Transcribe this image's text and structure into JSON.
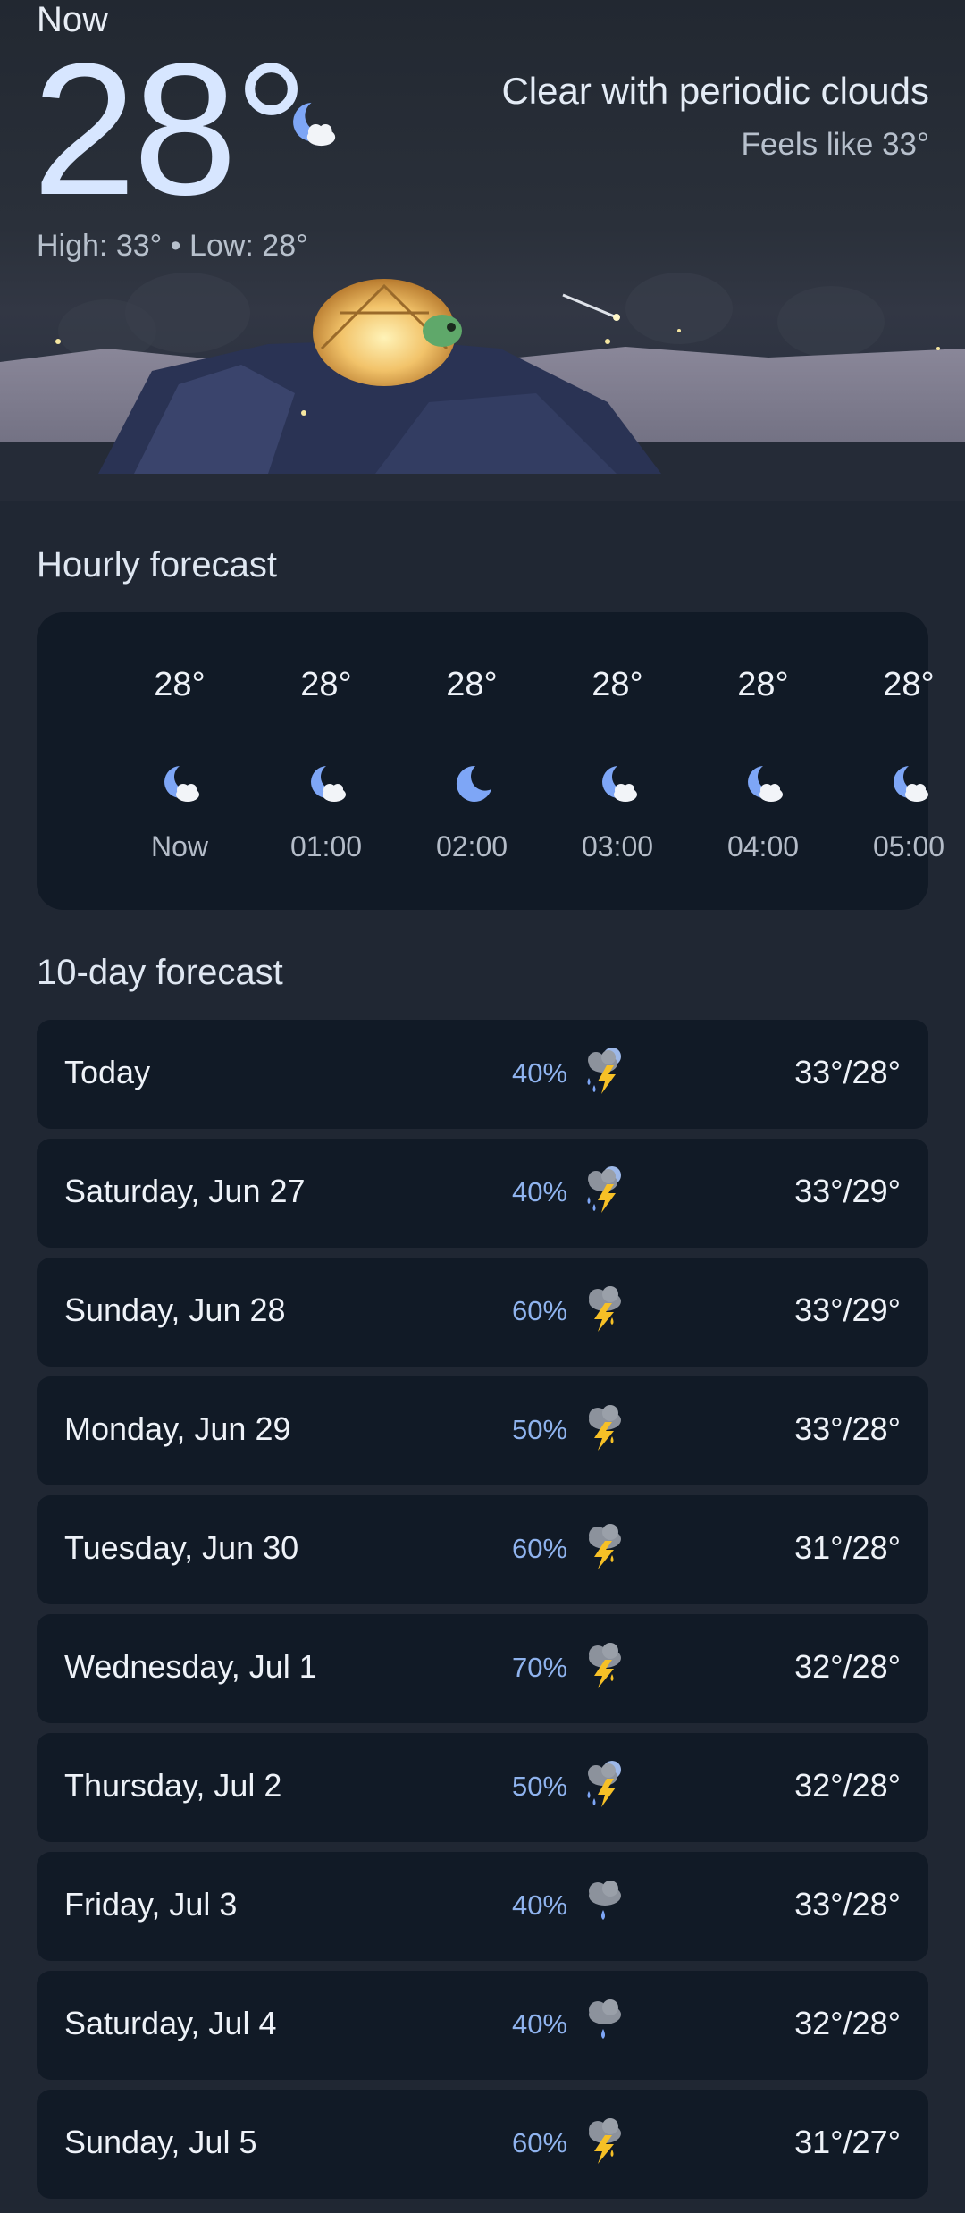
{
  "current": {
    "label": "Now",
    "temp": "28°",
    "icon": "moon-cloud-icon",
    "high_low": "High: 33° • Low: 28°",
    "condition": "Clear with periodic clouds",
    "feels_like": "Feels like 33°"
  },
  "hourly": {
    "title": "Hourly forecast",
    "items": [
      {
        "temp": "28°",
        "time": "Now",
        "icon": "moon-cloud-icon"
      },
      {
        "temp": "28°",
        "time": "01:00",
        "icon": "moon-cloud-icon"
      },
      {
        "temp": "28°",
        "time": "02:00",
        "icon": "moon-icon"
      },
      {
        "temp": "28°",
        "time": "03:00",
        "icon": "moon-cloud-icon"
      },
      {
        "temp": "28°",
        "time": "04:00",
        "icon": "moon-cloud-icon"
      },
      {
        "temp": "28°",
        "time": "05:00",
        "icon": "moon-cloud-icon"
      }
    ]
  },
  "daily": {
    "title": "10-day forecast",
    "items": [
      {
        "day": "Today",
        "precip": "40%",
        "icon": "scattered-thunderstorm-icon",
        "high_low": "33°/28°"
      },
      {
        "day": "Saturday, Jun 27",
        "precip": "40%",
        "icon": "scattered-thunderstorm-icon",
        "high_low": "33°/29°"
      },
      {
        "day": "Sunday, Jun 28",
        "precip": "60%",
        "icon": "thunderstorm-icon",
        "high_low": "33°/29°"
      },
      {
        "day": "Monday, Jun 29",
        "precip": "50%",
        "icon": "thunderstorm-icon",
        "high_low": "33°/28°"
      },
      {
        "day": "Tuesday, Jun 30",
        "precip": "60%",
        "icon": "thunderstorm-icon",
        "high_low": "31°/28°"
      },
      {
        "day": "Wednesday, Jul 1",
        "precip": "70%",
        "icon": "thunderstorm-icon",
        "high_low": "32°/28°"
      },
      {
        "day": "Thursday, Jul 2",
        "precip": "50%",
        "icon": "scattered-thunderstorm-icon",
        "high_low": "32°/28°"
      },
      {
        "day": "Friday, Jul 3",
        "precip": "40%",
        "icon": "rain-cloud-icon",
        "high_low": "33°/28°"
      },
      {
        "day": "Saturday, Jul 4",
        "precip": "40%",
        "icon": "rain-cloud-icon",
        "high_low": "32°/28°"
      },
      {
        "day": "Sunday, Jul 5",
        "precip": "60%",
        "icon": "thunderstorm-icon",
        "high_low": "31°/27°"
      }
    ]
  },
  "colors": {
    "background": "#202733",
    "card": "#111a26",
    "accent_precip": "#8fb3ee",
    "temp_big": "#d7e6ff",
    "moon": "#7ea6f6",
    "bolt": "#f6c026"
  }
}
